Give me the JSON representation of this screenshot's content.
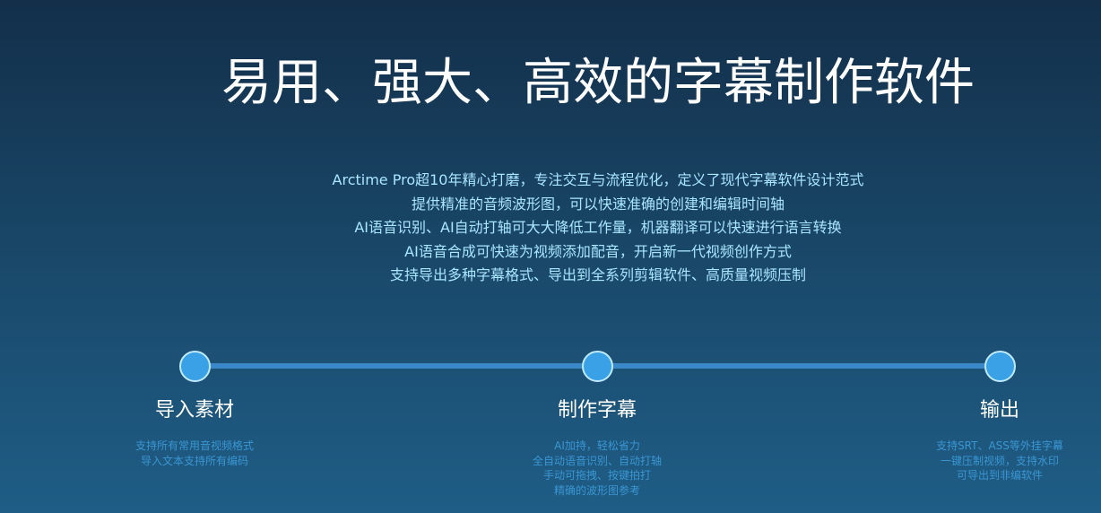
{
  "hero": {
    "title": "易用、强大、高效的字幕制作软件",
    "desc_lines": [
      "Arctime Pro超10年精心打磨，专注交互与流程优化，定义了现代字幕软件设计范式",
      "提供精准的音频波形图，可以快速准确的创建和编辑时间轴",
      "AI语音识别、AI自动打轴可大大降低工作量，机器翻译可以快速进行语言转换",
      "AI语音合成可快速为视频添加配音，开启新一代视频创作方式",
      "支持导出多种字幕格式、导出到全系列剪辑软件、高质量视频压制"
    ]
  },
  "steps": [
    {
      "title": "导入素材",
      "lines": [
        "支持所有常用音视频格式",
        "导入文本支持所有编码"
      ]
    },
    {
      "title": "制作字幕",
      "lines": [
        "AI加持，轻松省力",
        "全自动语音识别、自动打轴",
        "手动可拖拽、按键拍打",
        "精确的波形图参考"
      ]
    },
    {
      "title": "输出",
      "lines": [
        "支持SRT、ASS等外挂字幕",
        "一键压制视频，支持水印",
        "可导出到非编软件"
      ]
    }
  ],
  "colors": {
    "accent": "#3aa1e6",
    "line": "#3b88c8",
    "desc_text": "#a9e6ff",
    "sub_text": "#3a96d2"
  }
}
